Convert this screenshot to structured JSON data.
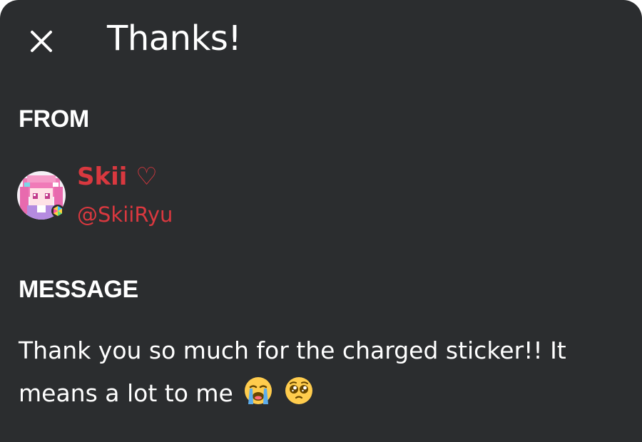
{
  "dialog": {
    "title": "Thanks!",
    "close_icon": "close-icon"
  },
  "from": {
    "label": "FROM",
    "display_name": "Skii ♡",
    "username": "@SkiiRyu",
    "name_color": "#d9383f"
  },
  "message": {
    "label": "MESSAGE",
    "text": "Thank you so much for the charged sticker!! It means a lot to me",
    "emojis": [
      "loudly-crying-face-emoji",
      "pleading-face-emoji"
    ]
  },
  "colors": {
    "background": "#2b2d2f",
    "text": "#ffffff",
    "accent": "#d9383f"
  }
}
